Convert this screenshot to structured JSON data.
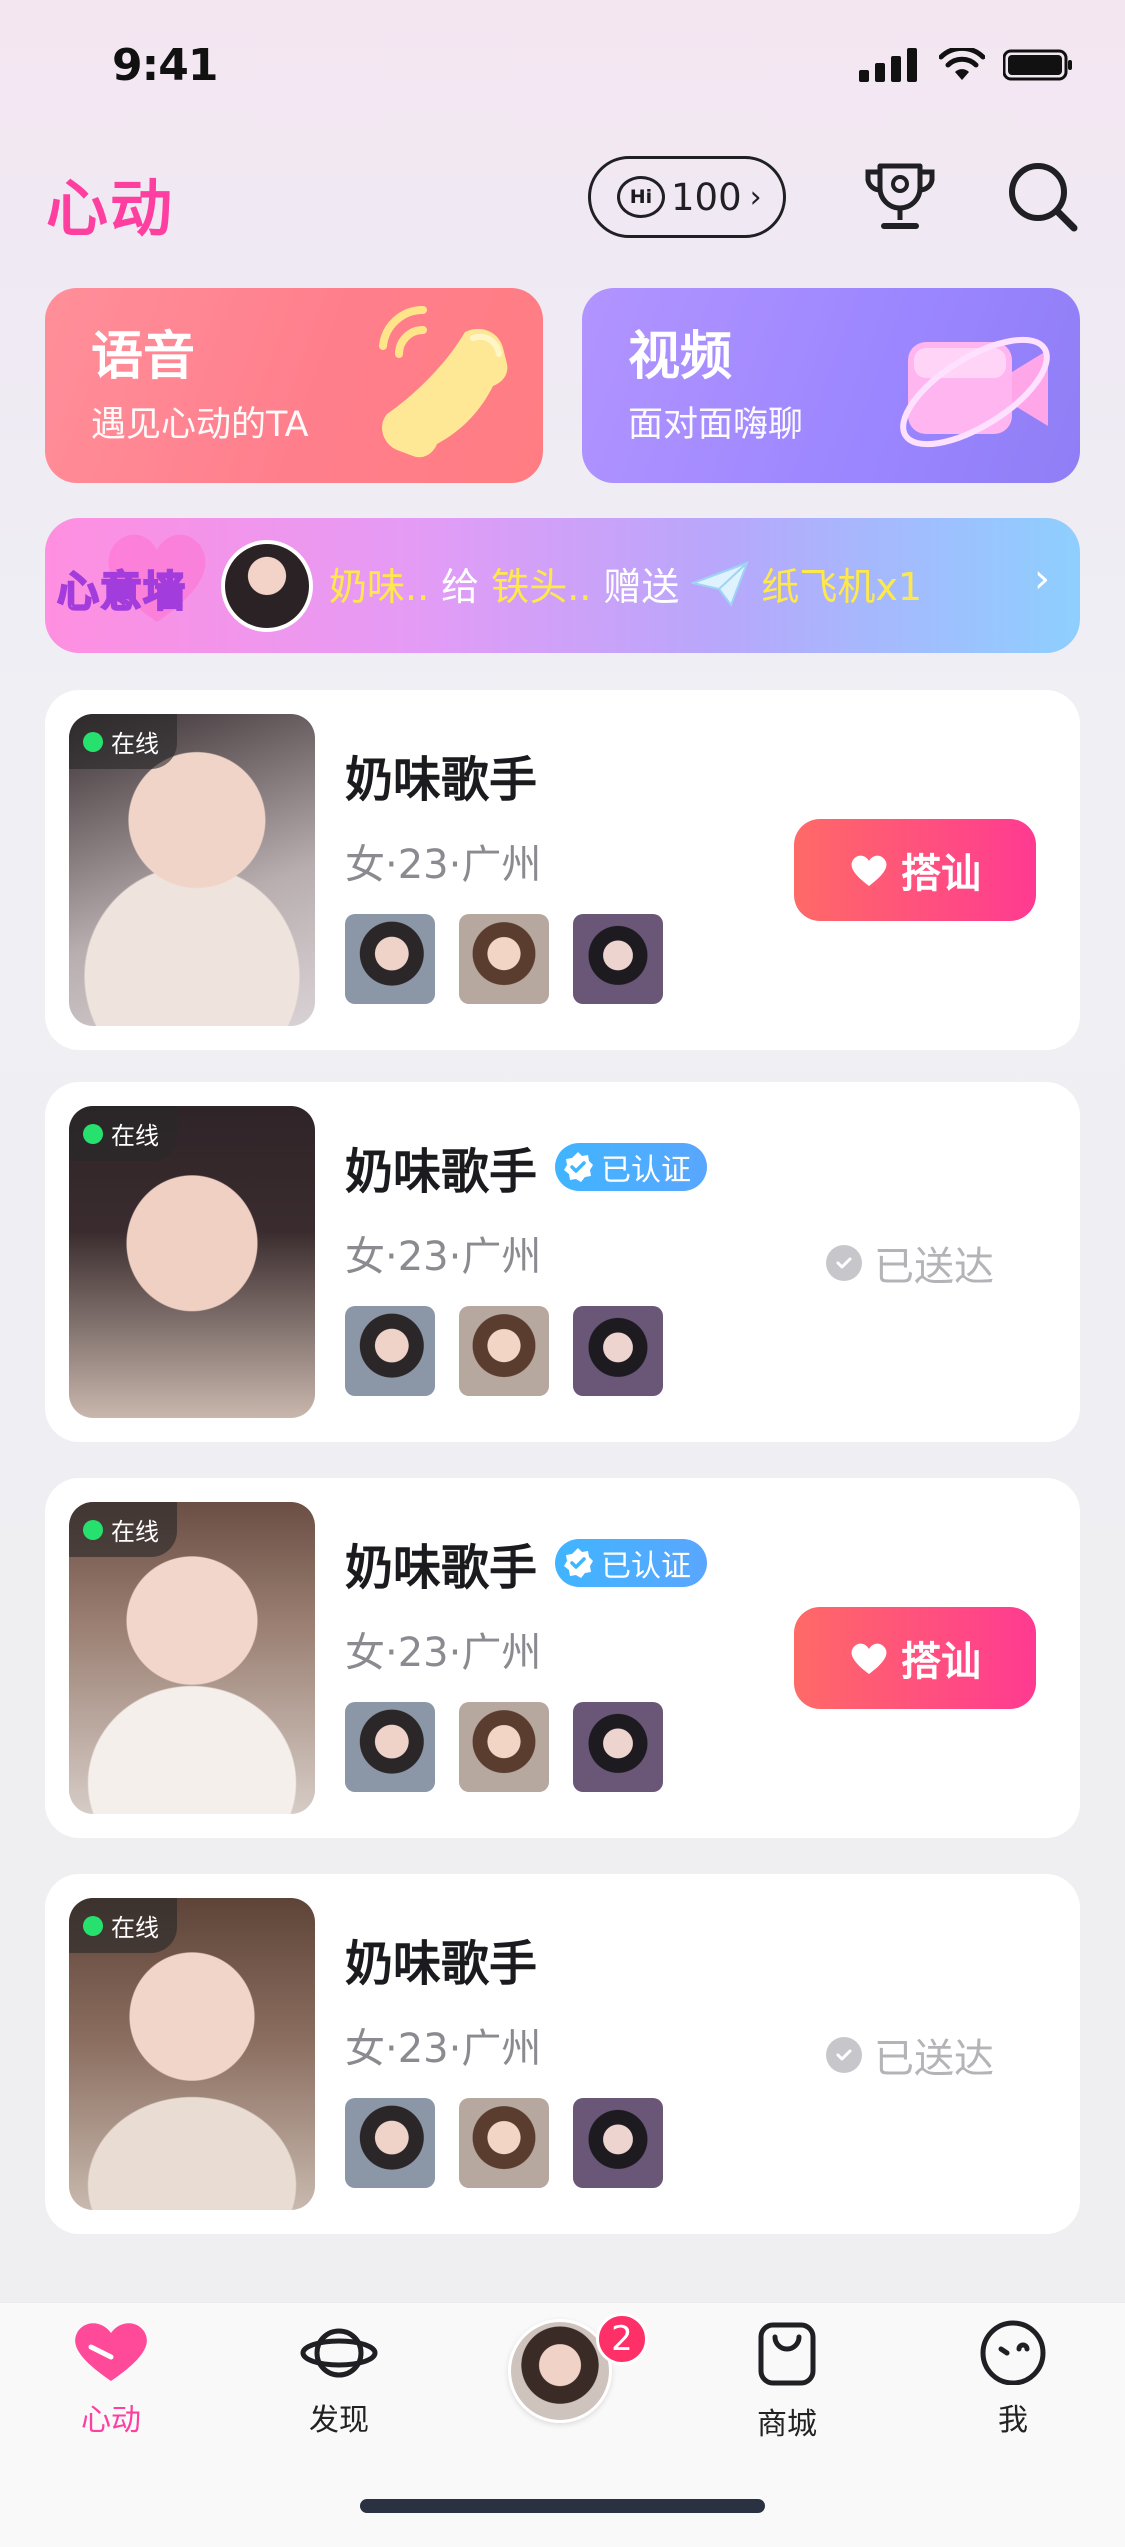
{
  "status": {
    "time": "9:41"
  },
  "header": {
    "title": "心动",
    "hi_count": "100"
  },
  "features": {
    "voice": {
      "title": "语音",
      "subtitle": "遇见心动的TA"
    },
    "video": {
      "title": "视频",
      "subtitle": "面对面嗨聊"
    }
  },
  "wall": {
    "label": "心意墙",
    "sender": "奶味..",
    "give": "给",
    "receiver": "铁头..",
    "sent": "赠送",
    "gift": "纸飞机x1"
  },
  "users": [
    {
      "name": "奶味歌手",
      "verified": false,
      "verified_label": "",
      "online_label": "在线",
      "meta": "女·23·广州",
      "action": "greet",
      "action_label": "搭讪"
    },
    {
      "name": "奶味歌手",
      "verified": true,
      "verified_label": "已认证",
      "online_label": "在线",
      "meta": "女·23·广州",
      "action": "delivered",
      "action_label": "已送达"
    },
    {
      "name": "奶味歌手",
      "verified": true,
      "verified_label": "已认证",
      "online_label": "在线",
      "meta": "女·23·广州",
      "action": "greet",
      "action_label": "搭讪"
    },
    {
      "name": "奶味歌手",
      "verified": false,
      "verified_label": "",
      "online_label": "在线",
      "meta": "女·23·广州",
      "action": "delivered",
      "action_label": "已送达"
    }
  ],
  "tabs": {
    "heart": "心动",
    "discover": "发现",
    "mall": "商城",
    "me": "我",
    "badge": "2"
  },
  "colors": {
    "accent": "#ff3fa0",
    "greet_start": "#ff6a67",
    "greet_end": "#ff3a91",
    "verified": "#40b5ff",
    "online": "#27e16f"
  }
}
